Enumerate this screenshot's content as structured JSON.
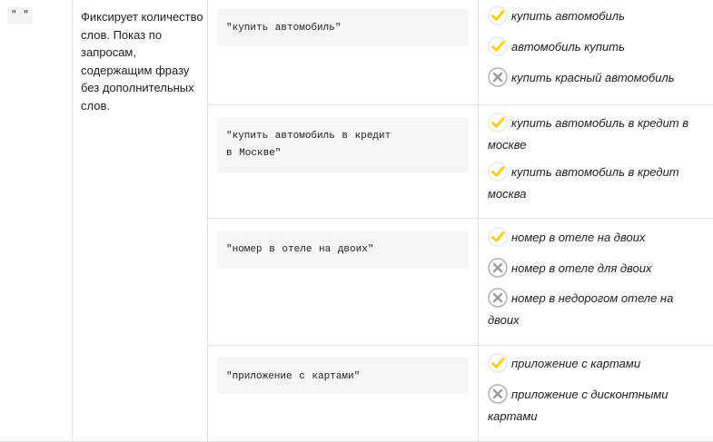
{
  "operator": {
    "code": "\" \"",
    "description": "Фиксирует количество слов. Показ по запросам, содержащим фразу без дополнительных слов."
  },
  "rows": [
    {
      "query": "\"купить автомобиль\"",
      "results": [
        {
          "icon": "check-icon",
          "text": "купить автомобиль"
        },
        {
          "icon": "check-icon",
          "text": "автомобиль купить"
        },
        {
          "icon": "cross-icon",
          "text": "купить красный автомобиль"
        }
      ]
    },
    {
      "query": "\"купить автомобиль в кредит\nв Москве\"",
      "results": [
        {
          "icon": "check-icon",
          "text": "купить автомобиль в кредит в москве"
        },
        {
          "icon": "check-icon",
          "text": "купить автомобиль в кредит москва"
        }
      ]
    },
    {
      "query": "\"номер в отеле на двоих\"",
      "results": [
        {
          "icon": "check-icon",
          "text": "номер в отеле на двоих"
        },
        {
          "icon": "cross-icon",
          "text": "номер в отеле для двоих"
        },
        {
          "icon": "cross-icon",
          "text": "номер в недорогом отеле на двоих"
        }
      ]
    },
    {
      "query": "\"приложение с картами\"",
      "results": [
        {
          "icon": "check-icon",
          "text": "приложение с картами"
        },
        {
          "icon": "cross-icon",
          "text": "приложение с дисконтными картами"
        }
      ]
    }
  ],
  "colors": {
    "check_ring": "#e8e8e8",
    "check_mark": "#ffcc00",
    "cross_ring": "#b0b0b0",
    "cross_mark": "#9a9a9a"
  }
}
